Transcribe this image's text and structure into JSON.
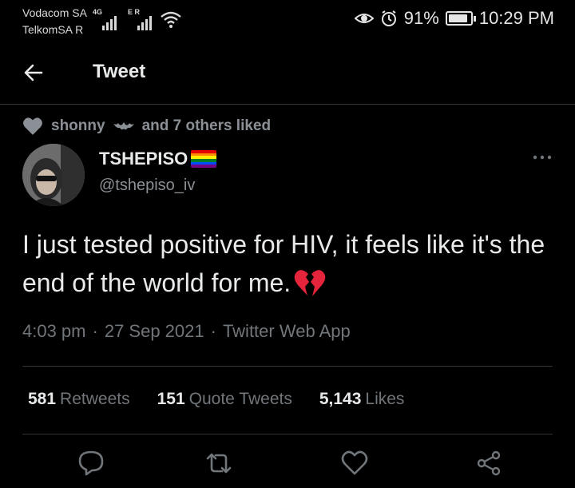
{
  "status_bar": {
    "carrier_1": "Vodacom SA",
    "carrier_2": "TelkomSA R",
    "network_1": "4G",
    "network_2": "E R",
    "battery": "91%",
    "battery_level": 0.91,
    "time": "10:29 PM",
    "icons": [
      "eye-icon",
      "alarm-icon",
      "battery-icon",
      "wifi-icon"
    ]
  },
  "header": {
    "back_icon": "arrow-left-icon",
    "title": "Tweet"
  },
  "social_context": {
    "user": "shonny",
    "text": "and 7 others liked"
  },
  "tweet": {
    "display_name": "TSHEPISO",
    "handle": "@tshepiso_iv",
    "text": "I just tested positive for HIV, it feels like it's the end of the world for me.",
    "time": "4:03 pm",
    "date": "27 Sep 2021",
    "source": "Twitter Web App",
    "sep": "·"
  },
  "stats": {
    "retweets_count": "581",
    "retweets_label": "Retweets",
    "quotes_count": "151",
    "quotes_label": "Quote Tweets",
    "likes_count": "5,143",
    "likes_label": "Likes"
  },
  "actions": [
    "reply-icon",
    "retweet-icon",
    "like-icon",
    "share-icon"
  ],
  "colors": {
    "background": "#000000",
    "text": "#e7e9ea",
    "secondary": "#71767b",
    "divider": "#2f3336"
  }
}
